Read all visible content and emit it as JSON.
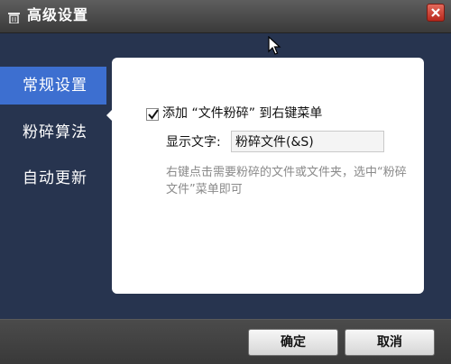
{
  "window": {
    "title": "高级设置",
    "title_icon": "trash-icon",
    "close_icon": "close-icon"
  },
  "nav": {
    "items": [
      {
        "label": "常规设置",
        "active": true
      },
      {
        "label": "粉碎算法",
        "active": false
      },
      {
        "label": "自动更新",
        "active": false
      }
    ]
  },
  "general": {
    "context_menu_checkbox": {
      "label": "添加 “文件粉碎” 到右键菜单",
      "checked": true
    },
    "display_text": {
      "label": "显示文字:",
      "value": "粉碎文件(&S)"
    },
    "hint": "右键点击需要粉碎的文件或文件夹，选中“粉碎文件”菜单即可"
  },
  "footer": {
    "ok_label": "确定",
    "cancel_label": "取消"
  },
  "colors": {
    "background": "#27344f",
    "nav_active": "#3d6fd0",
    "close_button": "#c8392b"
  }
}
